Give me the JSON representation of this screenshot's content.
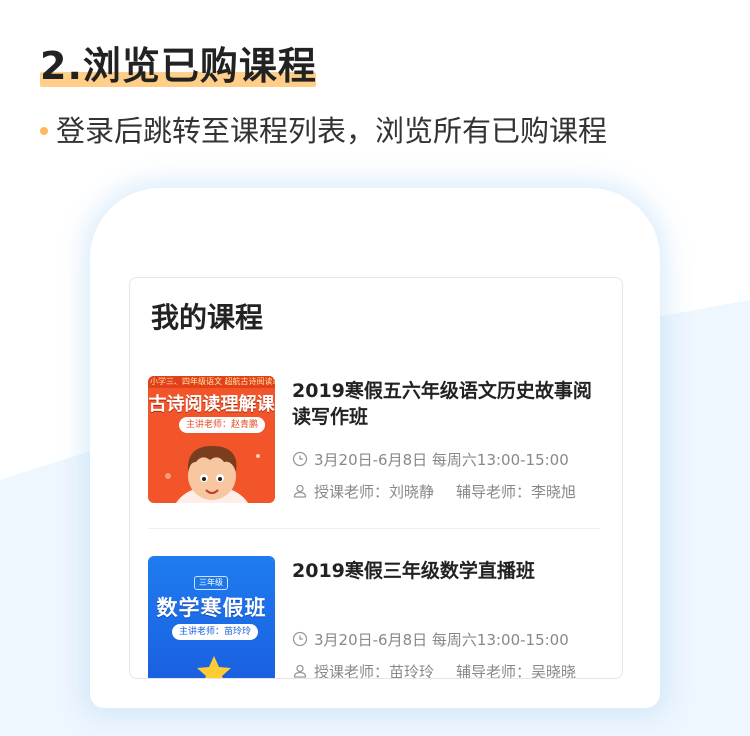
{
  "header": {
    "title": "2.浏览已购课程",
    "subtitle": "登录后跳转至课程列表，浏览所有已购课程"
  },
  "card": {
    "title": "我的课程"
  },
  "courses": [
    {
      "title": "2019寒假五六年级语文历史故事阅读写作班",
      "schedule": "3月20日-6月8日  每周六13:00-15:00",
      "teacher": "授课老师：刘晓静",
      "assistant": "辅导老师：李晓旭",
      "thumb": {
        "strip": "小学三、四年级语文    超航古诗阅读寒假班",
        "headline": "古诗阅读理解课",
        "teacher_pill": "主讲老师：赵青鹏"
      }
    },
    {
      "title": "2019寒假三年级数学直播班",
      "schedule": "3月20日-6月8日  每周六13:00-15:00",
      "teacher": "授课老师：苗玲玲",
      "assistant": "辅导老师：吴晓晓",
      "thumb": {
        "grade": "三年级",
        "headline": "数学寒假班",
        "teacher_pill": "主讲老师：苗玲玲"
      }
    }
  ],
  "colors": {
    "accent": "#ffb85c",
    "highlight": "#ffcf8a",
    "thumb_red": "#f2552a",
    "thumb_blue": "#1f7cf0"
  }
}
